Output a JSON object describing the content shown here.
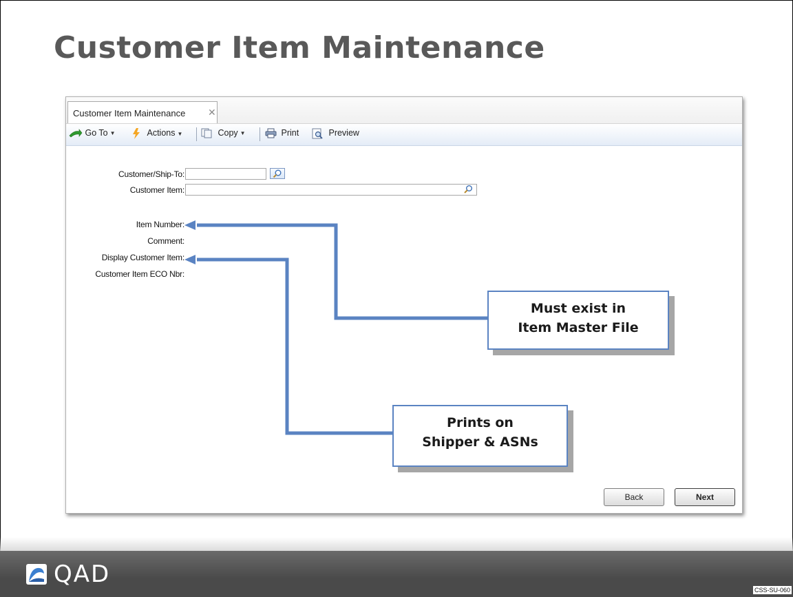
{
  "slide": {
    "title": "Customer Item Maintenance",
    "code": "CSS-SU-060",
    "logo_text": "QAD"
  },
  "window": {
    "tab": {
      "label": "Customer Item Maintenance",
      "close": "✕"
    },
    "toolbar": {
      "goto": "Go To",
      "actions": "Actions",
      "copy": "Copy",
      "print": "Print",
      "preview": "Preview"
    },
    "fields": {
      "customer_ship_to": {
        "label": "Customer/Ship-To:",
        "value": ""
      },
      "customer_item": {
        "label": "Customer Item:",
        "value": ""
      },
      "item_number": {
        "label": "Item Number:"
      },
      "comment": {
        "label": "Comment:"
      },
      "display_customer_item": {
        "label": "Display Customer Item:"
      },
      "customer_item_eco_nbr": {
        "label": "Customer Item ECO Nbr:"
      }
    },
    "buttons": {
      "back": "Back",
      "next": "Next"
    }
  },
  "callouts": {
    "item_master": {
      "line1": "Must exist in",
      "line2": "Item Master File"
    },
    "shipper": {
      "line1": "Prints on",
      "line2": "Shipper & ASNs"
    }
  },
  "colors": {
    "title": "#595959",
    "callout_border": "#5a83c2",
    "arrow": "#5a83c2",
    "footer": "#555555"
  },
  "icons": [
    "green-arrow-icon",
    "lightning-icon",
    "copy-icon",
    "printer-icon",
    "preview-icon",
    "magnifier-icon"
  ]
}
